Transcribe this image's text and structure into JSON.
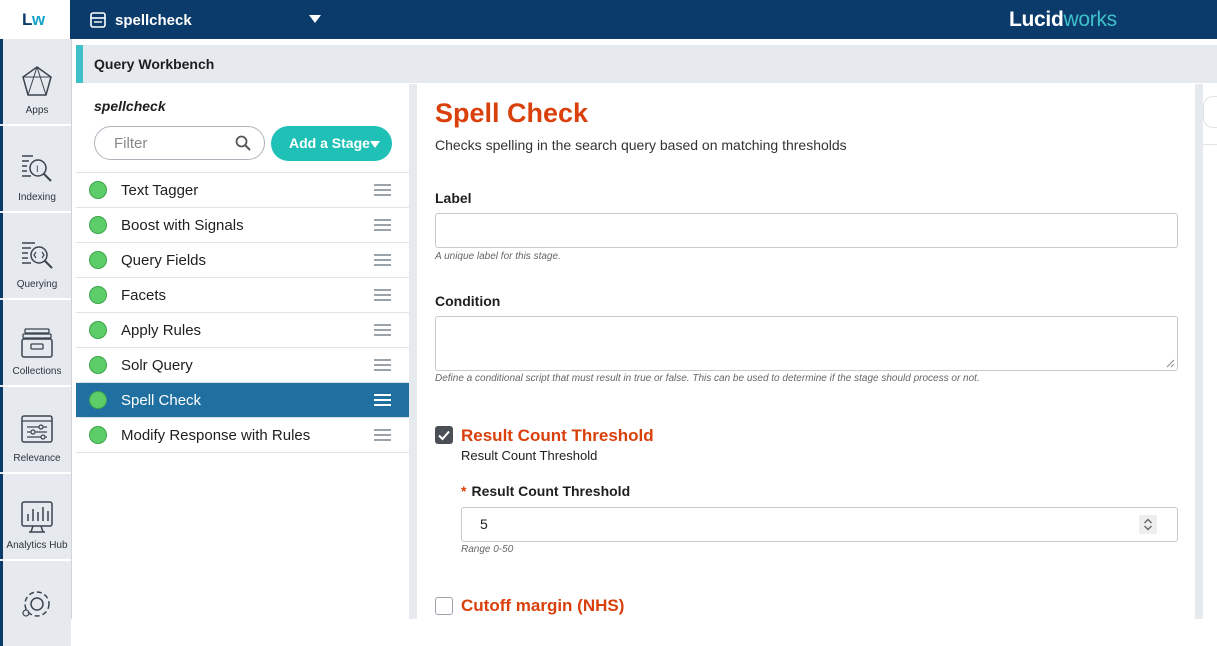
{
  "header": {
    "logo_main": "L",
    "logo_accent": "w",
    "app_name": "spellcheck",
    "brand_main": "Lucid",
    "brand_accent": "works"
  },
  "nav": [
    {
      "label": "Apps",
      "icon": "apps-icon"
    },
    {
      "label": "Indexing",
      "icon": "indexing-icon"
    },
    {
      "label": "Querying",
      "icon": "querying-icon"
    },
    {
      "label": "Collections",
      "icon": "collections-icon"
    },
    {
      "label": "Relevance",
      "icon": "relevance-icon"
    },
    {
      "label": "Analytics Hub",
      "icon": "analytics-hub-icon"
    },
    {
      "label": "",
      "icon": "settings-gear-icon"
    }
  ],
  "workbench": {
    "title": "Query Workbench"
  },
  "pipeline": {
    "name": "spellcheck",
    "filter_placeholder": "Filter",
    "add_stage_label": "Add a Stage",
    "stages": [
      {
        "name": "Text Tagger",
        "active": false
      },
      {
        "name": "Boost with Signals",
        "active": false
      },
      {
        "name": "Query Fields",
        "active": false
      },
      {
        "name": "Facets",
        "active": false
      },
      {
        "name": "Apply Rules",
        "active": false
      },
      {
        "name": "Solr Query",
        "active": false
      },
      {
        "name": "Spell Check",
        "active": true
      },
      {
        "name": "Modify Response with Rules",
        "active": false
      }
    ]
  },
  "stage_config": {
    "title": "Spell Check",
    "description": "Checks spelling in the search query based on matching thresholds",
    "label_field": {
      "label": "Label",
      "value": "",
      "hint": "A unique label for this stage."
    },
    "condition_field": {
      "label": "Condition",
      "value": "",
      "hint": "Define a conditional script that must result in true or false. This can be used to determine if the stage should process or not."
    },
    "result_count": {
      "checked": true,
      "title": "Result Count Threshold",
      "subtitle": "Result Count Threshold",
      "required_marker": "*",
      "field_label": "Result Count Threshold",
      "value": "5",
      "range_hint": "Range 0-50"
    },
    "cutoff_margin": {
      "checked": false,
      "title": "Cutoff margin (NHS)"
    }
  },
  "colors": {
    "topbar": "#0b3b6b",
    "accent_teal": "#1fc0b5",
    "title_orange": "#d9400b",
    "active_stage": "#1f6fa1",
    "status_green": "#5ccd68"
  }
}
